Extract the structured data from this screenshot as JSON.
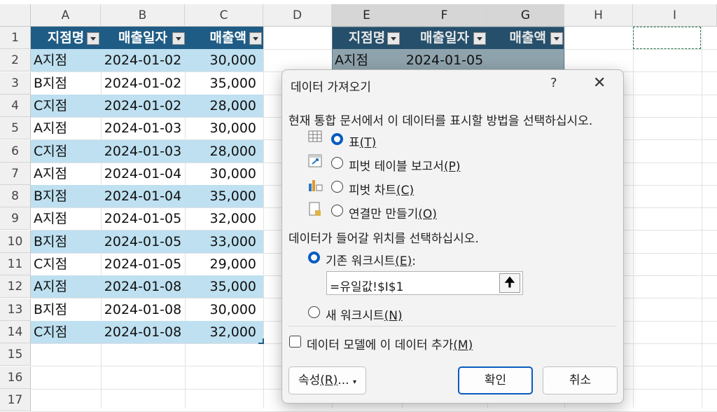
{
  "columns": [
    "A",
    "B",
    "C",
    "D",
    "E",
    "F",
    "G",
    "H",
    "I"
  ],
  "rows": [
    "1",
    "2",
    "3",
    "4",
    "5",
    "6",
    "7",
    "8",
    "9",
    "10",
    "11",
    "12",
    "13",
    "14",
    "15",
    "16",
    "17"
  ],
  "table1": {
    "headers": [
      "지점명",
      "매출일자",
      "매출액"
    ],
    "rows": [
      [
        "A지점",
        "2024-01-02",
        "30,000"
      ],
      [
        "B지점",
        "2024-01-02",
        "35,000"
      ],
      [
        "C지점",
        "2024-01-02",
        "28,000"
      ],
      [
        "A지점",
        "2024-01-03",
        "30,000"
      ],
      [
        "C지점",
        "2024-01-03",
        "28,000"
      ],
      [
        "A지점",
        "2024-01-04",
        "30,000"
      ],
      [
        "B지점",
        "2024-01-04",
        "35,000"
      ],
      [
        "A지점",
        "2024-01-05",
        "32,000"
      ],
      [
        "B지점",
        "2024-01-05",
        "33,000"
      ],
      [
        "C지점",
        "2024-01-05",
        "29,000"
      ],
      [
        "A지점",
        "2024-01-08",
        "35,000"
      ],
      [
        "B지점",
        "2024-01-08",
        "30,000"
      ],
      [
        "C지점",
        "2024-01-08",
        "32,000"
      ]
    ]
  },
  "table2": {
    "headers": [
      "지점명",
      "매출일자",
      "매출액"
    ],
    "row1": [
      "A지점",
      "2024-01-05",
      ""
    ]
  },
  "dialog": {
    "title": "데이터 가져오기",
    "help": "?",
    "close": "✕",
    "prompt_view": "현재 통합 문서에서 이 데이터를 표시할 방법을 선택하십시오.",
    "view_options": [
      {
        "label": "표",
        "key": "(T)",
        "selected": true,
        "icon": "table-icon"
      },
      {
        "label": "피벗 테이블 보고서",
        "key": "(P)",
        "selected": false,
        "icon": "pivot-table-icon"
      },
      {
        "label": "피벗 차트",
        "key": "(C)",
        "selected": false,
        "icon": "pivot-chart-icon"
      },
      {
        "label": "연결만 만들기",
        "key": "(O)",
        "selected": false,
        "icon": "connection-icon"
      }
    ],
    "prompt_location": "데이터가 들어갈 위치를 선택하십시오.",
    "existing_label": "기존 워크시트",
    "existing_key": "(E)",
    "existing_suffix": ":",
    "ref_value": "=유일값!$I$1",
    "new_label": "새 워크시트",
    "new_key": "(N)",
    "model_label": "데이터 모델에 이 데이터 추가",
    "model_key": "(M)",
    "props_label": "속성",
    "props_key": "(R)",
    "props_suffix": "...",
    "ok_label": "확인",
    "cancel_label": "취소"
  },
  "colors": {
    "table_header": "#1f5c85",
    "band": "#bee0f0",
    "accent": "#0a5bbf",
    "excel_green": "#217346"
  }
}
